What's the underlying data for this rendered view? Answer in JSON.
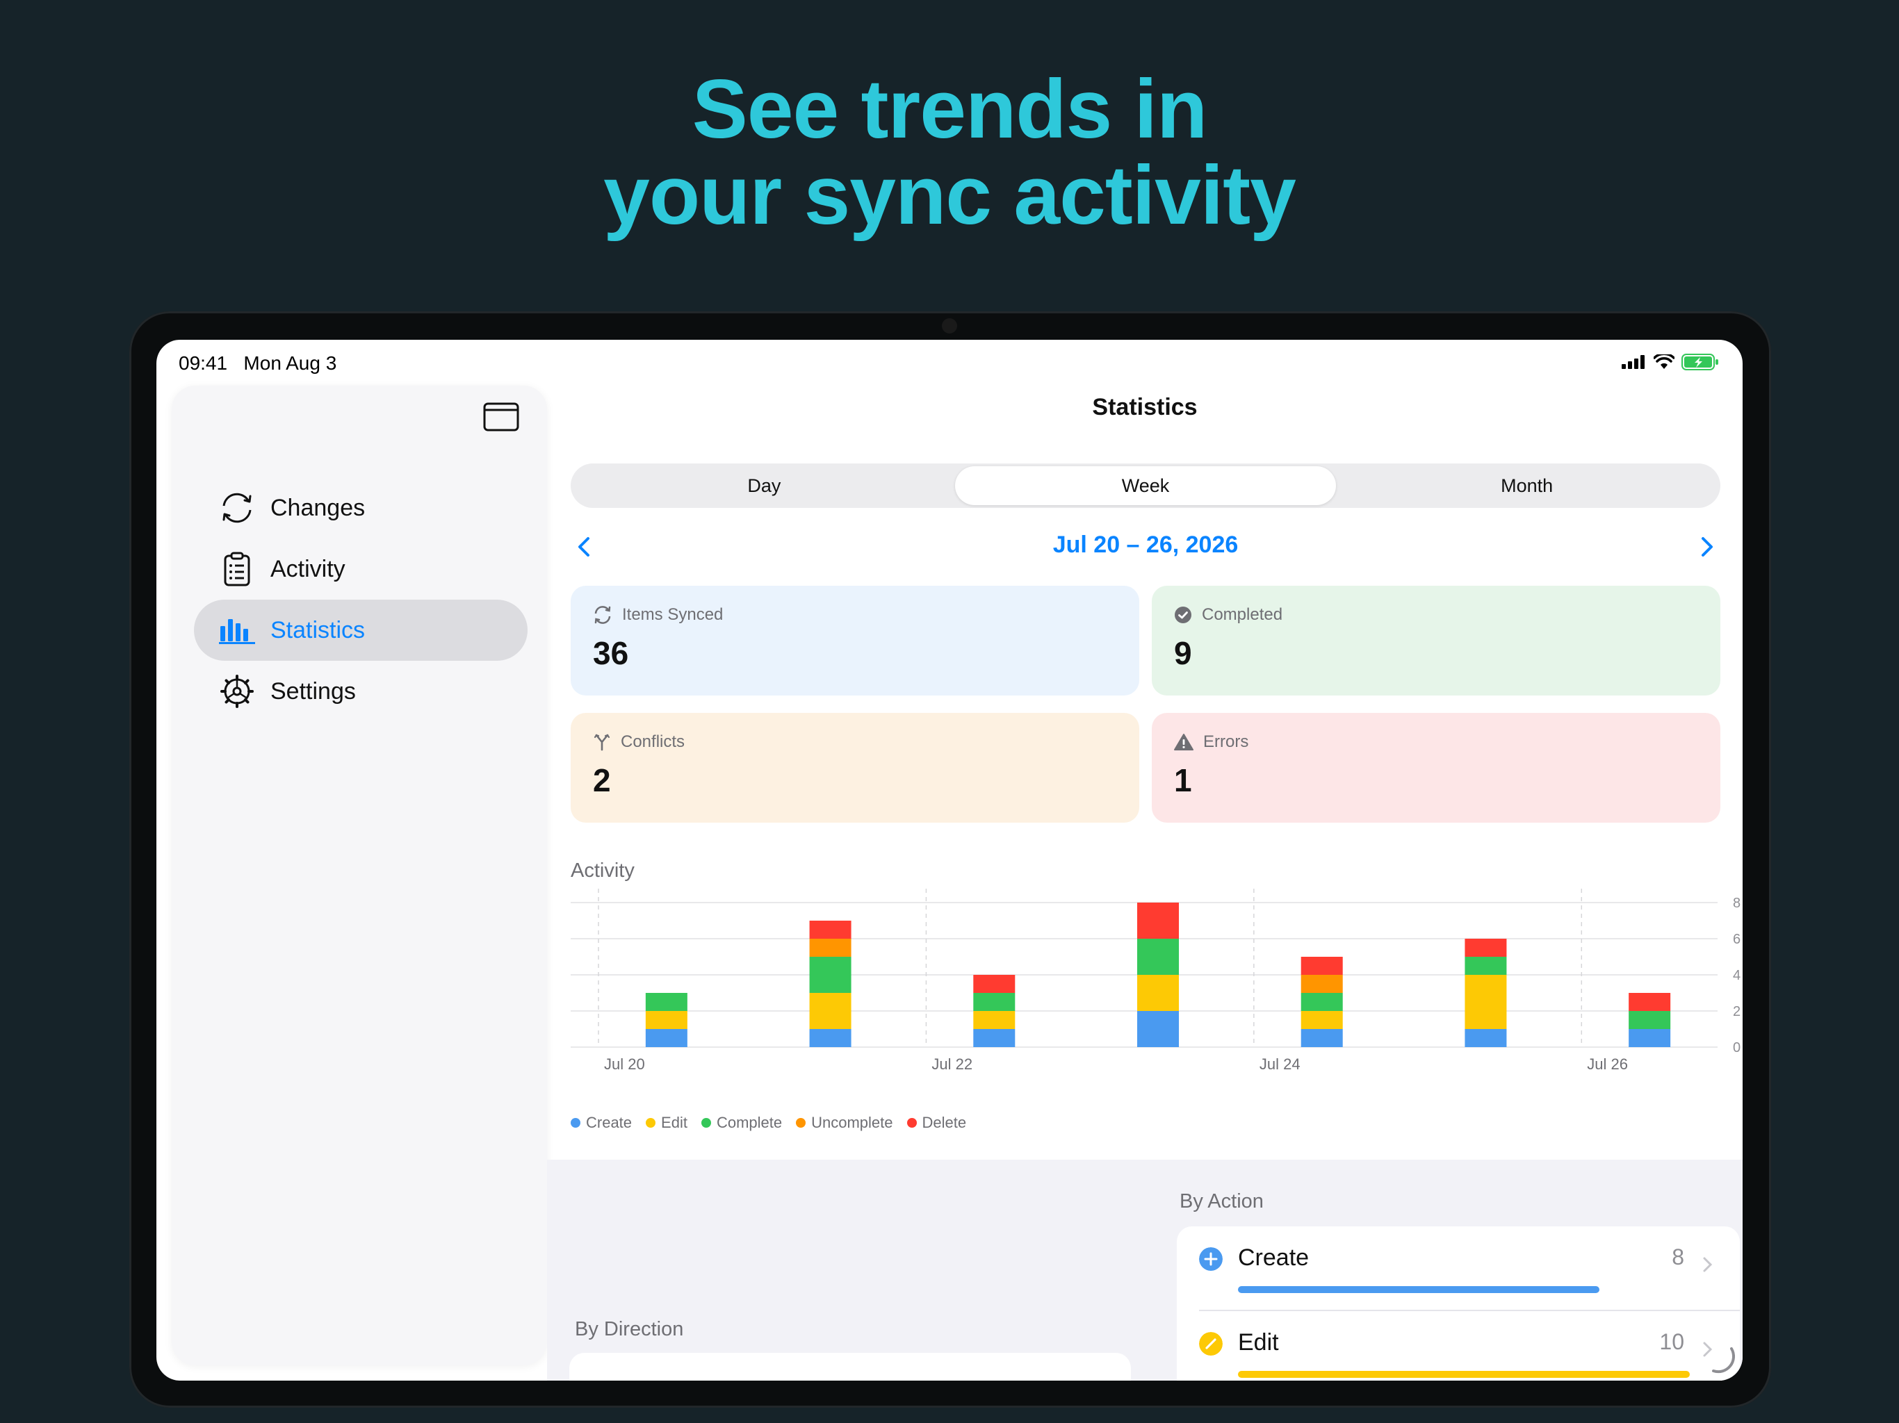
{
  "headline": {
    "line1": "See trends in",
    "line2": "your sync activity"
  },
  "status_bar": {
    "time": "09:41",
    "date": "Mon Aug 3"
  },
  "sidebar": {
    "items": [
      {
        "label": "Changes",
        "icon": "sync-arrows-icon",
        "active": false
      },
      {
        "label": "Activity",
        "icon": "clipboard-list-icon",
        "active": false
      },
      {
        "label": "Statistics",
        "icon": "bar-chart-icon",
        "active": true
      },
      {
        "label": "Settings",
        "icon": "gear-icon",
        "active": false
      }
    ]
  },
  "main": {
    "title": "Statistics",
    "segments": [
      {
        "label": "Day",
        "selected": false
      },
      {
        "label": "Week",
        "selected": true
      },
      {
        "label": "Month",
        "selected": false
      }
    ],
    "date_range": "Jul 20 – 26, 2026",
    "cards": [
      {
        "label": "Items Synced",
        "value": "36",
        "icon": "sync-icon",
        "color": "#eaf3fd"
      },
      {
        "label": "Completed",
        "value": "9",
        "icon": "checkmark-circle-icon",
        "color": "#e6f5e9"
      },
      {
        "label": "Conflicts",
        "value": "2",
        "icon": "merge-icon",
        "color": "#fdf1e1"
      },
      {
        "label": "Errors",
        "value": "1",
        "icon": "warning-triangle-icon",
        "color": "#fde6e7"
      }
    ],
    "activity_title": "Activity",
    "by_action_title": "By Action",
    "by_direction_title": "By Direction",
    "by_action": [
      {
        "label": "Create",
        "count": "8",
        "color": "#4a9af0",
        "fraction": 0.8
      },
      {
        "label": "Edit",
        "count": "10",
        "color": "#fdc905",
        "fraction": 1.0
      }
    ]
  },
  "chart_data": {
    "type": "bar",
    "stacked": true,
    "x": [
      "Jul 20",
      "Jul 21",
      "Jul 22",
      "Jul 23",
      "Jul 24",
      "Jul 25",
      "Jul 26"
    ],
    "x_tick_labels": [
      "Jul 20",
      "Jul 22",
      "Jul 24",
      "Jul 26"
    ],
    "ylim": [
      0,
      8
    ],
    "y_ticks": [
      0,
      2,
      4,
      6,
      8
    ],
    "grid": true,
    "legend_position": "bottom-left",
    "series": [
      {
        "name": "Create",
        "color": "#4a9af0",
        "values": [
          1,
          1,
          1,
          2,
          1,
          1,
          1
        ]
      },
      {
        "name": "Edit",
        "color": "#fdc905",
        "values": [
          1,
          2,
          1,
          2,
          1,
          3,
          0
        ]
      },
      {
        "name": "Complete",
        "color": "#34c759",
        "values": [
          1,
          2,
          1,
          2,
          1,
          1,
          1
        ]
      },
      {
        "name": "Uncomplete",
        "color": "#ff9500",
        "values": [
          0,
          1,
          0,
          0,
          1,
          0,
          0
        ]
      },
      {
        "name": "Delete",
        "color": "#ff3b30",
        "values": [
          0,
          1,
          1,
          2,
          1,
          1,
          1
        ]
      }
    ]
  }
}
